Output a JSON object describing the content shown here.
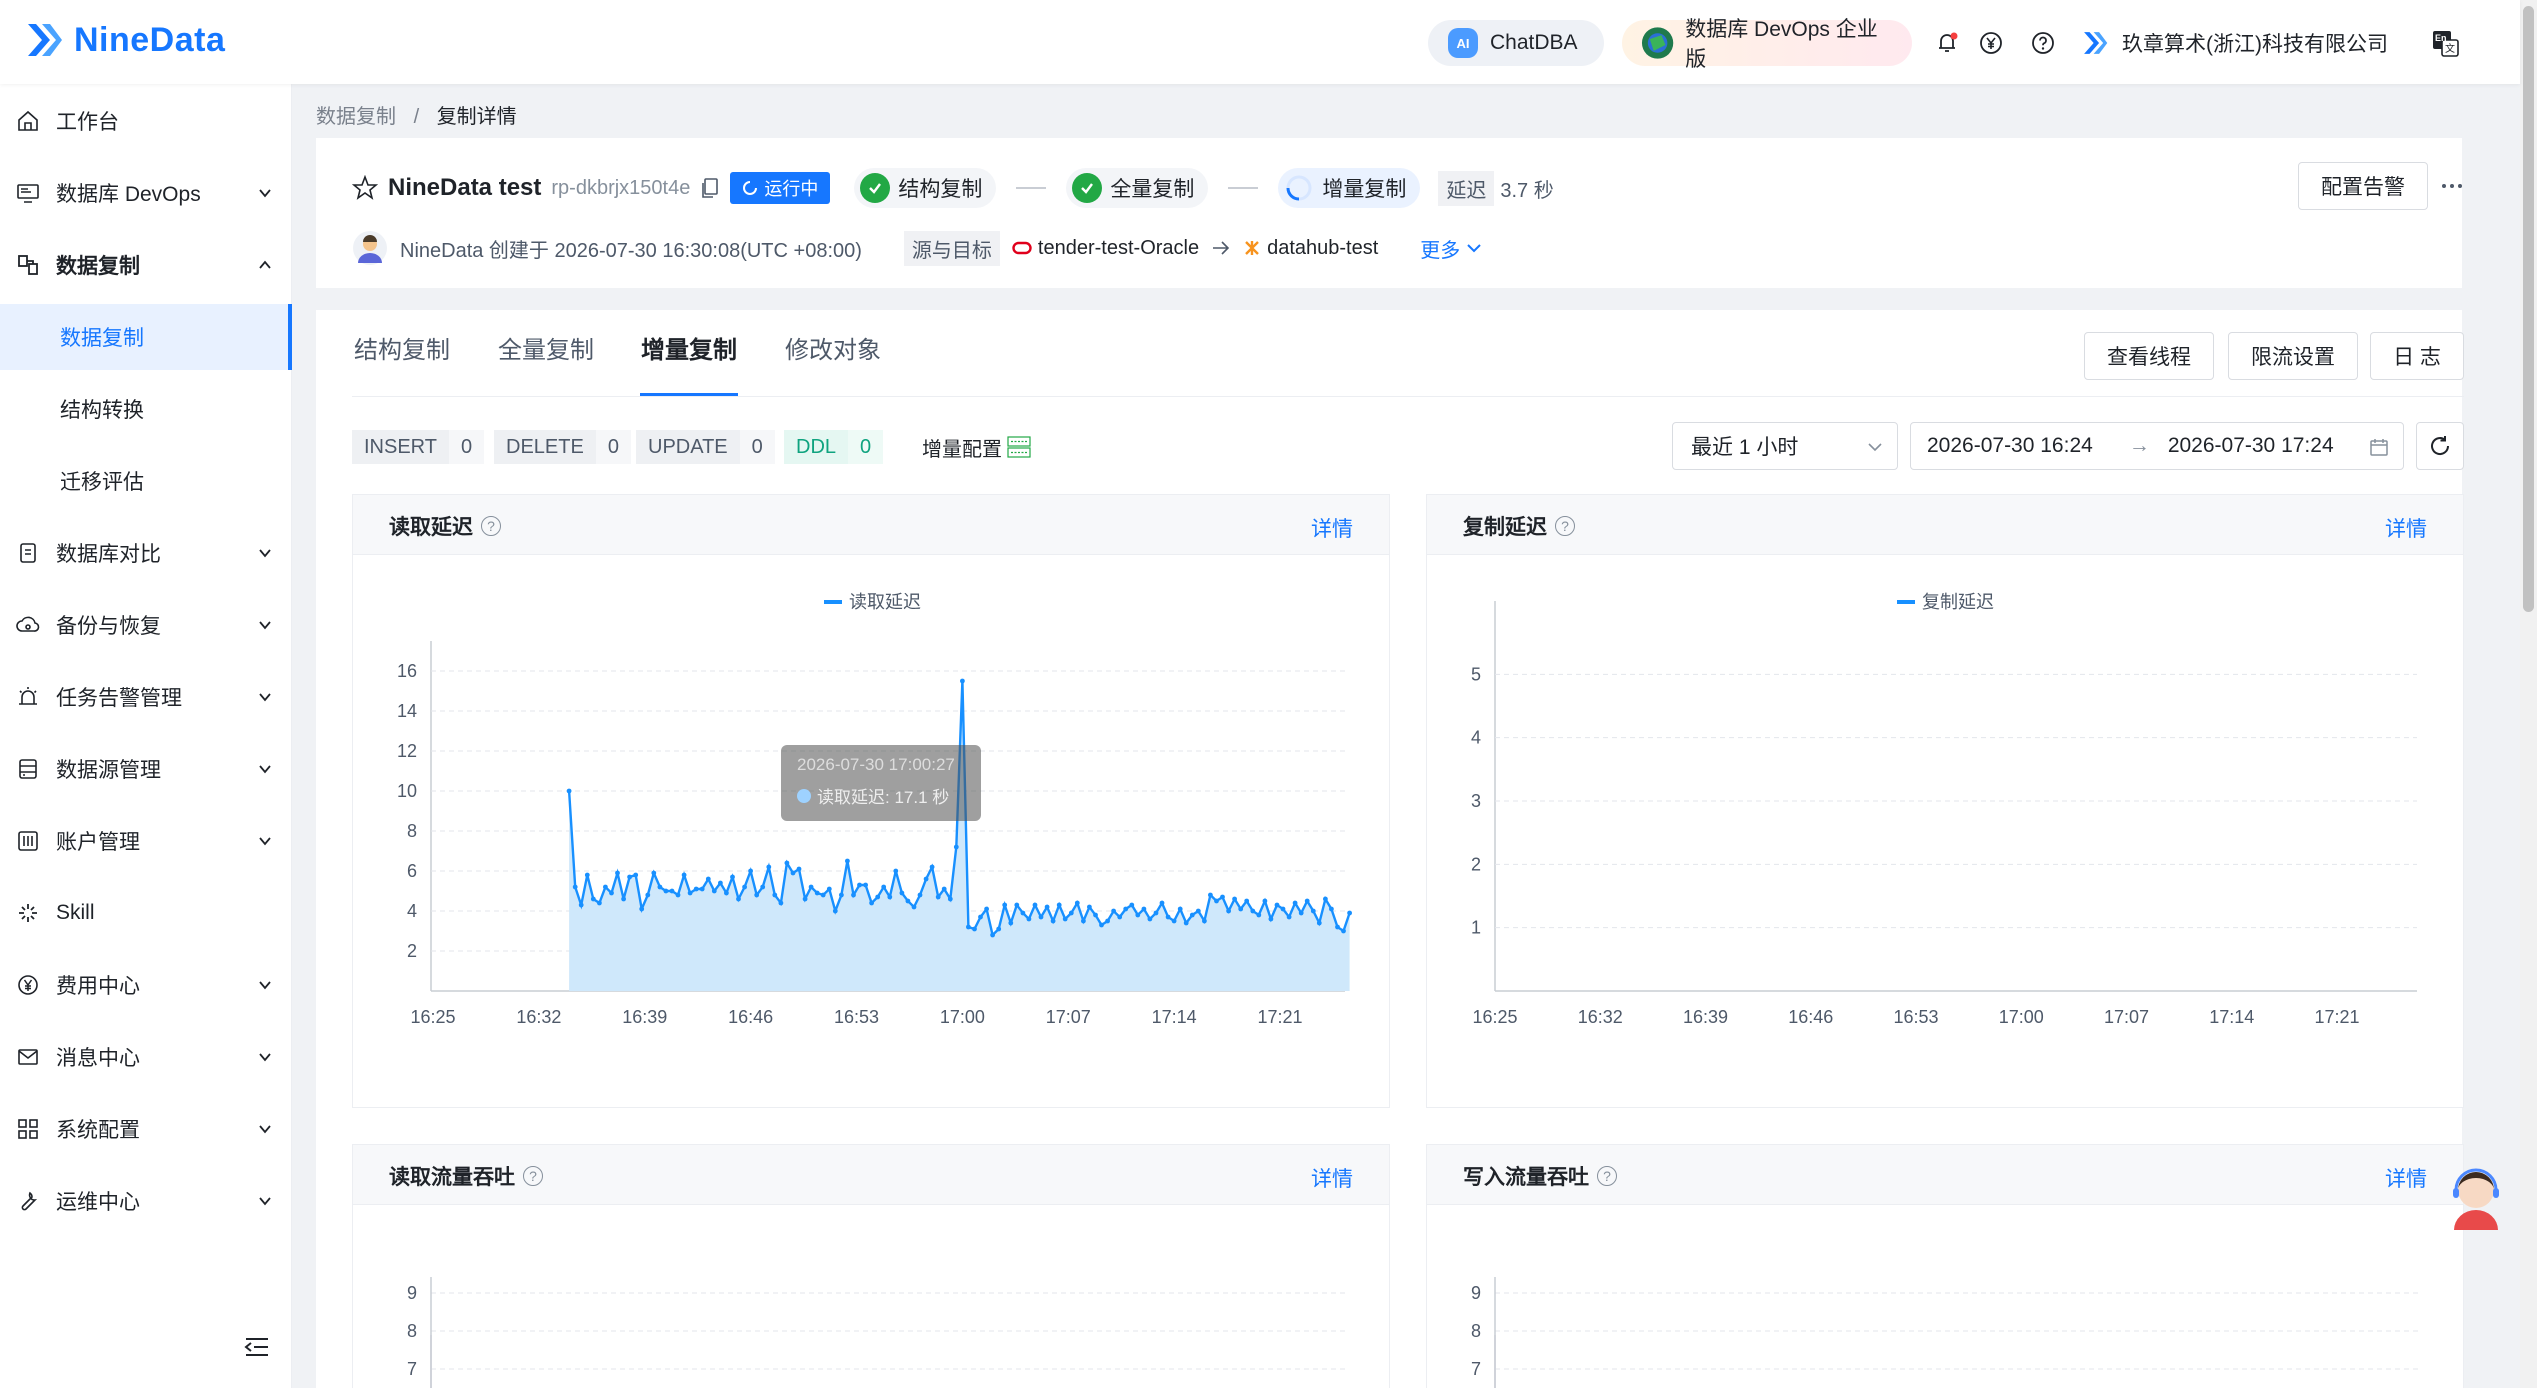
{
  "topbar": {
    "brand": "NineData",
    "chatdba": "ChatDBA",
    "edition": "数据库 DevOps 企业版",
    "company": "玖章算术(浙江)科技有限公司",
    "lang_badge": "En"
  },
  "sidebar": {
    "items": [
      {
        "label": "工作台",
        "icon": "home-icon"
      },
      {
        "label": "数据库 DevOps",
        "icon": "monitor-icon"
      },
      {
        "label": "数据复制",
        "icon": "replication-icon"
      },
      {
        "label": "数据复制",
        "sub": true
      },
      {
        "label": "结构转换",
        "sub": true
      },
      {
        "label": "迁移评估",
        "sub": true
      },
      {
        "label": "数据库对比",
        "icon": "compare-icon"
      },
      {
        "label": "备份与恢复",
        "icon": "backup-icon"
      },
      {
        "label": "任务告警管理",
        "icon": "alarm-icon"
      },
      {
        "label": "数据源管理",
        "icon": "datasource-icon"
      },
      {
        "label": "账户管理",
        "icon": "account-icon"
      },
      {
        "label": "Skill",
        "icon": "skill-icon"
      },
      {
        "label": "费用中心",
        "icon": "yen-icon"
      },
      {
        "label": "消息中心",
        "icon": "mail-icon"
      },
      {
        "label": "系统配置",
        "icon": "grid-icon"
      },
      {
        "label": "运维中心",
        "icon": "wrench-icon"
      }
    ]
  },
  "breadcrumb": {
    "parent": "数据复制",
    "sep": "/",
    "current": "复制详情"
  },
  "task": {
    "name": "NineData test",
    "id": "rp-dkbrjx150t4e",
    "status": "运行中",
    "stages": [
      "结构复制",
      "全量复制",
      "增量复制"
    ],
    "delay_label": "延迟",
    "delay_value": "3.7 秒",
    "creator_line": "NineData 创建于 2026-07-30 16:30:08(UTC +08:00)",
    "src_dst_label": "源与目标",
    "source": "tender-test-Oracle",
    "target": "datahub-test",
    "more": "更多",
    "alarm_button": "配置告警"
  },
  "tabs": [
    "结构复制",
    "全量复制",
    "增量复制",
    "修改对象"
  ],
  "tab_actions": [
    "查看线程",
    "限流设置",
    "日 志"
  ],
  "counters": [
    {
      "label": "INSERT",
      "value": "0"
    },
    {
      "label": "DELETE",
      "value": "0"
    },
    {
      "label": "UPDATE",
      "value": "0"
    },
    {
      "label": "DDL",
      "value": "0"
    }
  ],
  "incr_config": "增量配置",
  "time_filter": {
    "range": "最近 1 小时",
    "start": "2026-07-30 16:24",
    "end": "2026-07-30 17:24",
    "arrow": "→"
  },
  "cards": {
    "read_delay": {
      "title": "读取延迟",
      "detail": "详情",
      "tooltip_time": "2026-07-30 17:00:27",
      "tooltip_value": "读取延迟: 17.1 秒"
    },
    "rep_delay": {
      "title": "复制延迟",
      "detail": "详情"
    },
    "read_tput": {
      "title": "读取流量吞吐",
      "detail": "详情"
    },
    "write_tput": {
      "title": "写入流量吞吐",
      "detail": "详情"
    }
  },
  "chart_data": [
    {
      "type": "area",
      "title": "读取延迟",
      "x_ticks": [
        "16:25",
        "16:32",
        "16:39",
        "16:46",
        "16:53",
        "17:00",
        "17:07",
        "17:14",
        "17:21"
      ],
      "y_ticks": [
        2,
        4,
        6,
        8,
        10,
        12,
        14,
        16
      ],
      "ylim": [
        0,
        17
      ],
      "series": [
        {
          "name": "读取延迟",
          "color": "#1890ff",
          "start_minute": 9,
          "step_minutes": 0.4,
          "values": [
            10,
            5.2,
            4.3,
            5.8,
            4.6,
            4.4,
            5.2,
            4.9,
            5.9,
            4.6,
            5.7,
            5.8,
            4.1,
            4.8,
            5.9,
            5.2,
            5,
            5,
            4.8,
            5.8,
            4.9,
            5.1,
            5.1,
            5.6,
            5,
            5.4,
            4.9,
            5.7,
            4.6,
            5.2,
            6,
            4.8,
            5.2,
            6.2,
            4.8,
            4.4,
            6.4,
            5.9,
            6.1,
            4.6,
            5.2,
            4.9,
            4.8,
            5.1,
            4,
            4.8,
            6.5,
            4.8,
            5.3,
            5.3,
            4.4,
            4.7,
            5.2,
            4.7,
            6,
            4.9,
            4.5,
            4.2,
            4.8,
            5.6,
            6.2,
            4.7,
            5.1,
            4.6,
            7.2,
            15.5,
            3.2,
            3.1,
            3.7,
            4.1,
            2.8,
            3.1,
            4.3,
            3.4,
            4.3,
            3.9,
            3.6,
            4.3,
            3.7,
            4.2,
            3.5,
            4.3,
            3.6,
            3.9,
            4.4,
            3.5,
            4.2,
            3.8,
            3.3,
            3.5,
            4,
            3.7,
            4.1,
            4.3,
            3.8,
            4.1,
            3.6,
            3.9,
            4.4,
            3.7,
            3.5,
            4.1,
            3.4,
            3.8,
            4,
            3.5,
            4.8,
            4.5,
            4.7,
            4,
            4.6,
            4.1,
            4.5,
            4,
            3.8,
            4.5,
            3.6,
            4.3,
            4.1,
            3.7,
            4.4,
            3.9,
            4.5,
            4,
            3.4,
            4.6,
            4.1,
            3.2,
            3,
            3.9
          ]
        }
      ]
    },
    {
      "type": "line",
      "title": "复制延迟",
      "x_ticks": [
        "16:25",
        "16:32",
        "16:39",
        "16:46",
        "16:53",
        "17:00",
        "17:07",
        "17:14",
        "17:21"
      ],
      "y_ticks": [
        1,
        2,
        3,
        4,
        5
      ],
      "ylim": [
        0,
        6
      ],
      "series": [
        {
          "name": "复制延迟",
          "color": "#1890ff",
          "values": []
        }
      ]
    },
    {
      "type": "line",
      "title": "读取流量吞吐",
      "y_ticks": [
        7,
        8,
        9
      ],
      "series": []
    },
    {
      "type": "line",
      "title": "写入流量吞吐",
      "y_ticks": [
        7,
        8,
        9
      ],
      "series": []
    }
  ]
}
